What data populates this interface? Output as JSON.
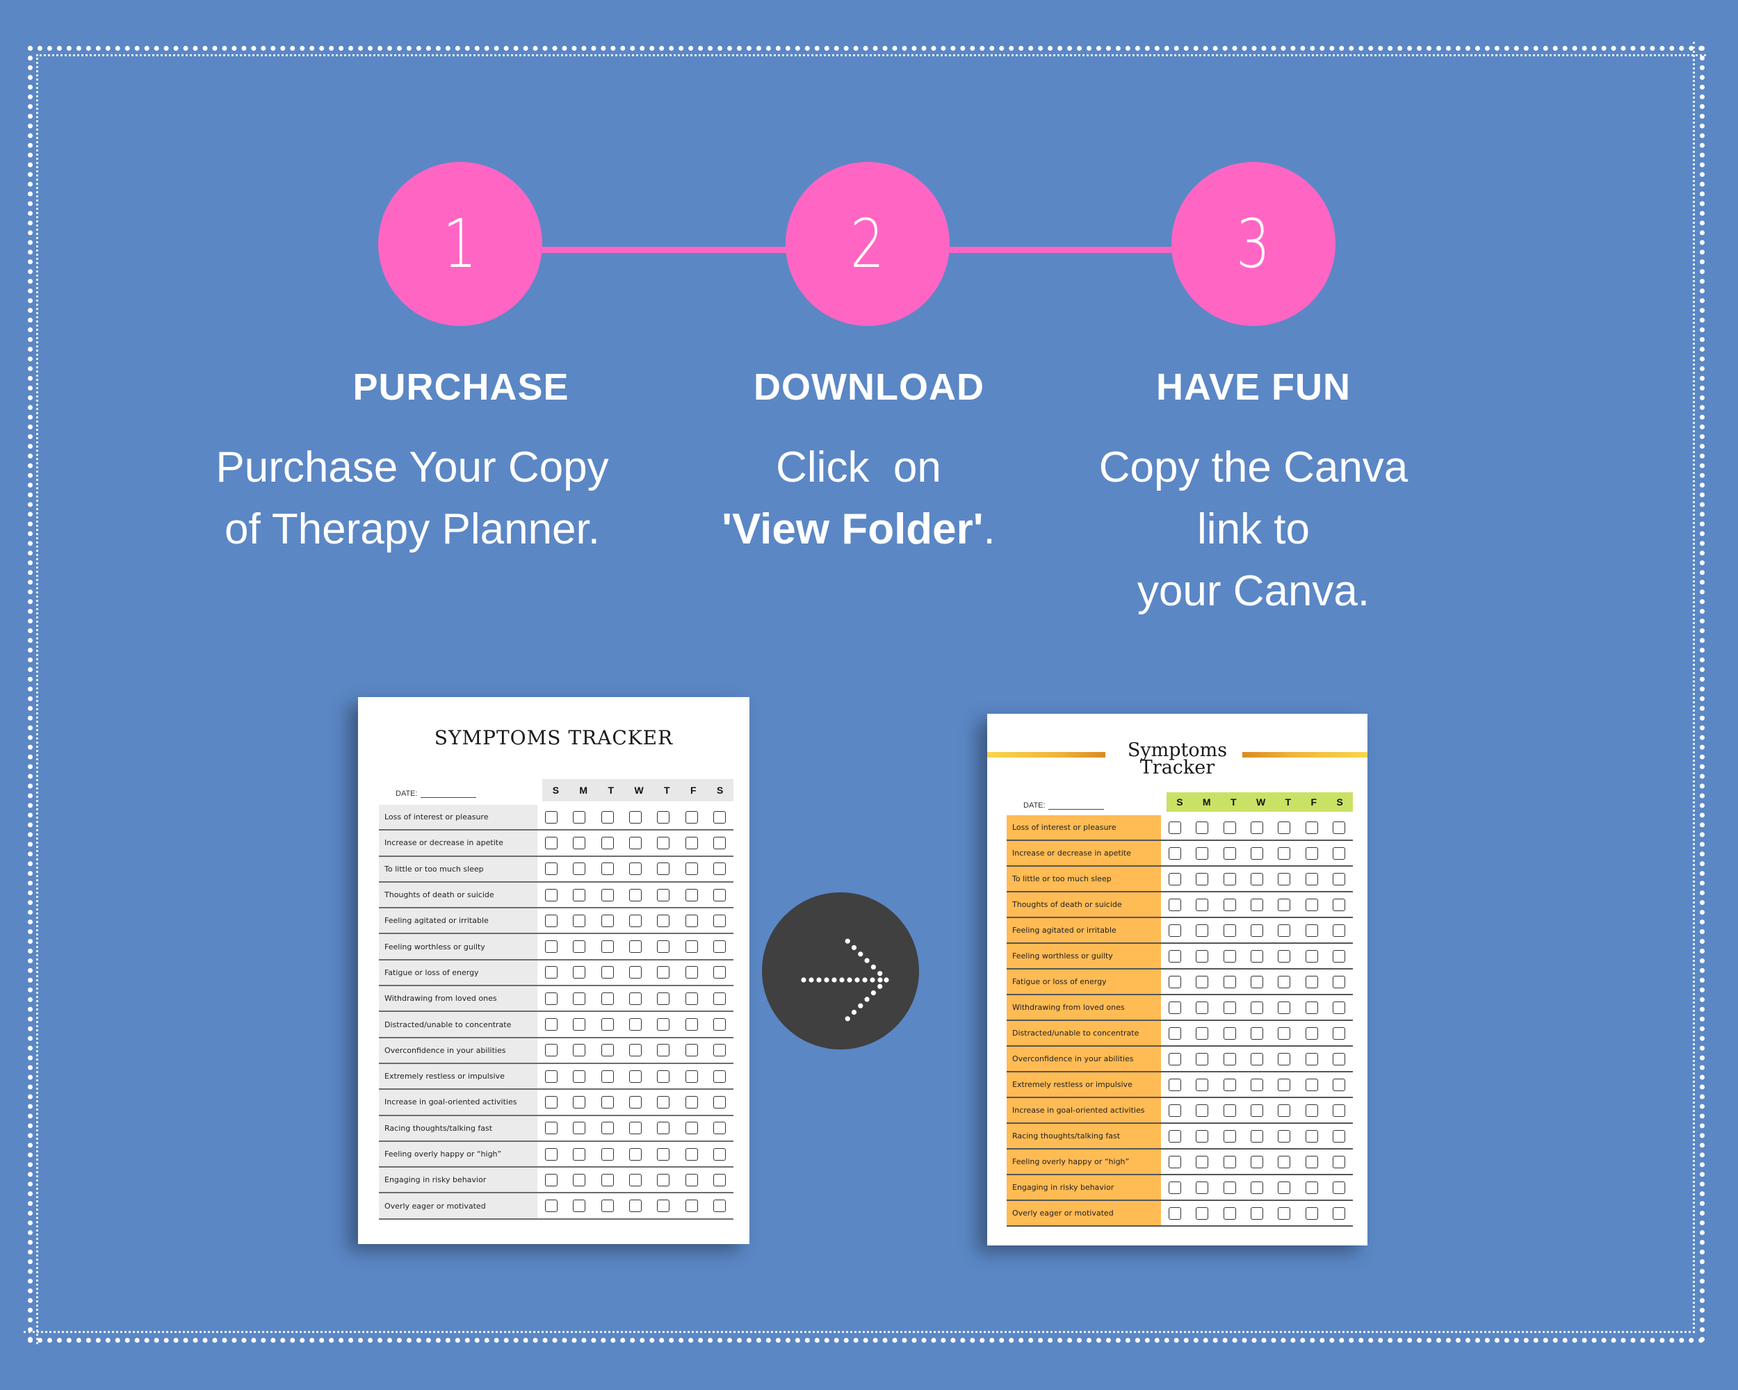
{
  "steps": [
    {
      "number": "1",
      "title": "PURCHASE",
      "body_lines": [
        "Purchase Your Copy",
        "of Therapy Planner."
      ]
    },
    {
      "number": "2",
      "title": "DOWNLOAD",
      "body_line1": "Click  on",
      "body_bold": "'View Folder'",
      "body_after": "."
    },
    {
      "number": "3",
      "title": "HAVE FUN",
      "body_lines": [
        "Copy the Canva",
        "link to",
        "your Canva."
      ]
    }
  ],
  "colors": {
    "background": "#5b87c5",
    "step_accent": "#ff66c4",
    "arrow_circle": "#404040",
    "right_label_fill": "#ffbb54",
    "right_days_fill": "#c9e265"
  },
  "arrow_icon": "dotted-arrow-right-icon",
  "preview_before": {
    "title": "SYMPTOMS TRACKER",
    "date_label": "DATE:",
    "days": [
      "S",
      "M",
      "T",
      "W",
      "T",
      "F",
      "S"
    ],
    "symptoms": [
      "Loss of interest or pleasure",
      "Increase or decrease in apetite",
      "To little or too much sleep",
      "Thoughts of death or suicide",
      "Feeling agitated or irritable",
      "Feeling worthless or guilty",
      "Fatigue or loss of energy",
      "Withdrawing from loved ones",
      "Distracted/unable to concentrate",
      "Overconfidence in your abilities",
      "Extremely restless or impulsive",
      "Increase in goal-oriented activities",
      "Racing thoughts/talking fast",
      "Feeling overly happy or “high”",
      "Engaging in risky behavior",
      "Overly eager or motivated"
    ]
  },
  "preview_after": {
    "title_line1": "Symptoms",
    "title_line2": "Tracker",
    "date_label": "DATE:",
    "days": [
      "S",
      "M",
      "T",
      "W",
      "T",
      "F",
      "S"
    ],
    "symptoms": [
      "Loss of interest or pleasure",
      "Increase or decrease in apetite",
      "To little or too much sleep",
      "Thoughts of death or suicide",
      "Feeling agitated or irritable",
      "Feeling worthless or guilty",
      "Fatigue or loss of energy",
      "Withdrawing from loved ones",
      "Distracted/unable to concentrate",
      "Overconfidence in your abilities",
      "Extremely restless or impulsive",
      "Increase in goal-oriented activities",
      "Racing thoughts/talking fast",
      "Feeling overly happy or “high”",
      "Engaging in risky behavior",
      "Overly eager or motivated"
    ]
  }
}
